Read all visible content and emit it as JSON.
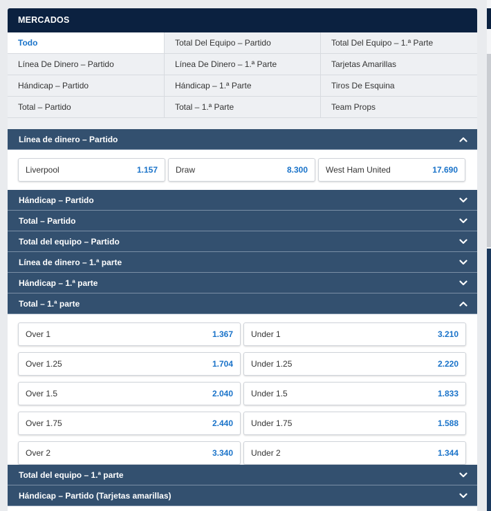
{
  "markets": {
    "title": "MERCADOS",
    "grid": [
      "Todo",
      "Total Del Equipo – Partido",
      "Total Del Equipo – 1.ª Parte",
      "Línea De Dinero – Partido",
      "Línea De Dinero – 1.ª Parte",
      "Tarjetas Amarillas",
      "Hándicap – Partido",
      "Hándicap – 1.ª Parte",
      "Tiros De Esquina",
      "Total – Partido",
      "Total – 1.ª Parte",
      "Team Props"
    ],
    "active": "Todo"
  },
  "sections": {
    "moneyline": {
      "title": "Línea de dinero – Partido",
      "odds": [
        {
          "label": "Liverpool",
          "value": "1.157"
        },
        {
          "label": "Draw",
          "value": "8.300"
        },
        {
          "label": "West Ham United",
          "value": "17.690"
        }
      ]
    },
    "collapsed": [
      "Hándicap – Partido",
      "Total – Partido",
      "Total del equipo – Partido",
      "Línea de dinero – 1.ª parte",
      "Hándicap – 1.ª parte"
    ],
    "total_first_half": {
      "title": "Total – 1.ª parte",
      "rows": [
        [
          {
            "label": "Over 1",
            "value": "1.367"
          },
          {
            "label": "Under 1",
            "value": "3.210"
          }
        ],
        [
          {
            "label": "Over 1.25",
            "value": "1.704"
          },
          {
            "label": "Under 1.25",
            "value": "2.220"
          }
        ],
        [
          {
            "label": "Over 1.5",
            "value": "2.040"
          },
          {
            "label": "Under 1.5",
            "value": "1.833"
          }
        ],
        [
          {
            "label": "Over 1.75",
            "value": "2.440"
          },
          {
            "label": "Under 1.75",
            "value": "1.588"
          }
        ],
        [
          {
            "label": "Over 2",
            "value": "3.340"
          },
          {
            "label": "Under 2",
            "value": "1.344"
          }
        ]
      ]
    },
    "after": [
      "Total del equipo – 1.ª parte",
      "Hándicap – Partido (Tarjetas amarillas)"
    ]
  },
  "colors": {
    "header_bg": "#0b2140",
    "section_bg": "#33506f",
    "odds_value": "#1a73c9",
    "active_tab": "#1a73c9"
  },
  "icons": {
    "expanded": "chevron-up-icon",
    "collapsed": "chevron-down-icon"
  }
}
